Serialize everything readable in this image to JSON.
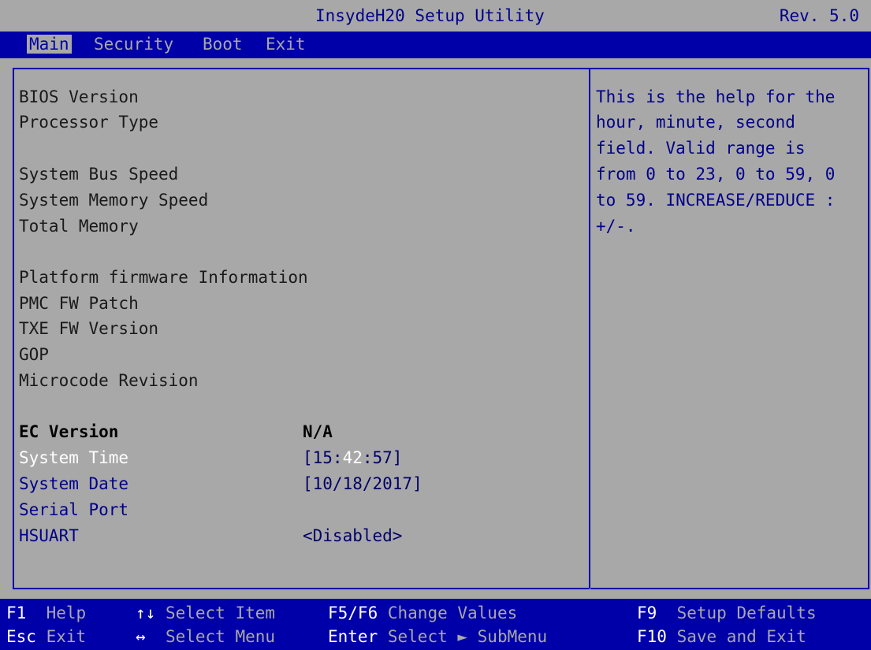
{
  "header": {
    "title": "InsydeH20 Setup Utility",
    "rev": "Rev. 5.0"
  },
  "menu": {
    "tabs": [
      "Main",
      "Security",
      "Boot",
      "Exit"
    ]
  },
  "main": {
    "items": [
      "BIOS Version",
      "Processor Type",
      "System Bus Speed",
      "System Memory Speed",
      "Total Memory",
      "Platform firmware Information",
      "PMC FW Patch",
      "TXE FW Version",
      "GOP",
      "Microcode Revision"
    ],
    "ec_version": {
      "label": "EC Version",
      "value": "N/A"
    },
    "system_time": {
      "label": "System Time",
      "open": "[15:",
      "current": "42",
      "close": ":57]"
    },
    "system_date": {
      "label": "System Date",
      "value": "[10/18/2017]"
    },
    "serial_port": {
      "label": "Serial Port"
    },
    "hsuart": {
      "label": "HSUART",
      "value": "<Disabled>"
    }
  },
  "help": {
    "lines": [
      "This is the help for the",
      "hour, minute, second",
      "field. Valid range is",
      "from 0 to 23, 0 to 59, 0",
      "to 59. INCREASE/REDUCE :",
      "+/-."
    ]
  },
  "footer": {
    "keys": [
      {
        "key": "F1",
        "desc": "Help"
      },
      {
        "key": "Esc",
        "desc": "Exit"
      },
      {
        "key": "↑↓",
        "desc": "Select Item"
      },
      {
        "key": "↔",
        "desc": "Select Menu"
      },
      {
        "key": "F5/F6",
        "desc": "Change Values"
      },
      {
        "key": "Enter",
        "desc": "Select ► SubMenu"
      },
      {
        "key": "F9",
        "desc": "Setup Defaults"
      },
      {
        "key": "F10",
        "desc": "Save and Exit"
      }
    ]
  },
  "colors": {
    "background": "#a8a8a8",
    "bar": "#0000a8",
    "link_text": "#00008b",
    "selected_text": "#ffffff"
  }
}
